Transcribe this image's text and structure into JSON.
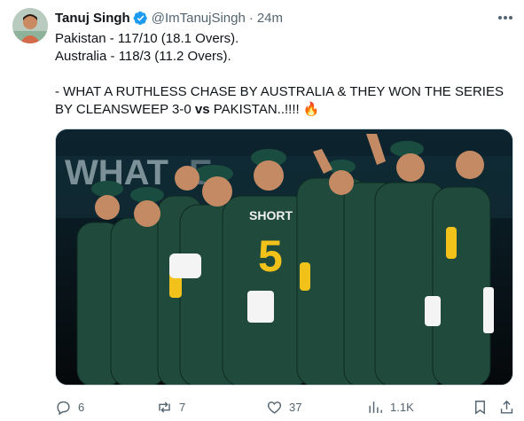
{
  "tweet": {
    "author_name": "Tanuj Singh",
    "handle": "@ImTanujSingh",
    "separator": "·",
    "time": "24m",
    "line1": "Pakistan - 117/10 (18.1 Overs).",
    "line2": "Australia - 118/3 (11.2 Overs).",
    "line3a": "- WHAT A RUTHLESS CHASE BY AUSTRALIA & THEY WON THE SERIES BY CLEANSWEEP 3-0 ",
    "line3b": "vs",
    "line3c": " PAKISTAN..!!!! ",
    "emoji": "🔥"
  },
  "media": {
    "jersey_name": "SHORT",
    "jersey_number": "5",
    "banner_text": "WHAT"
  },
  "actions": {
    "replies": "6",
    "reposts": "7",
    "likes": "37",
    "views": "1.1K"
  },
  "icons": {
    "verified": "verified-badge-icon",
    "more": "more-icon",
    "reply": "reply-icon",
    "repost": "repost-icon",
    "like": "like-icon",
    "views": "views-icon",
    "bookmark": "bookmark-icon",
    "share": "share-icon"
  },
  "colors": {
    "text": "#0f1419",
    "secondary": "#536471",
    "verified": "#1d9bf0",
    "jersey_green": "#1f4a3c",
    "jersey_yellow": "#f2c21b"
  }
}
